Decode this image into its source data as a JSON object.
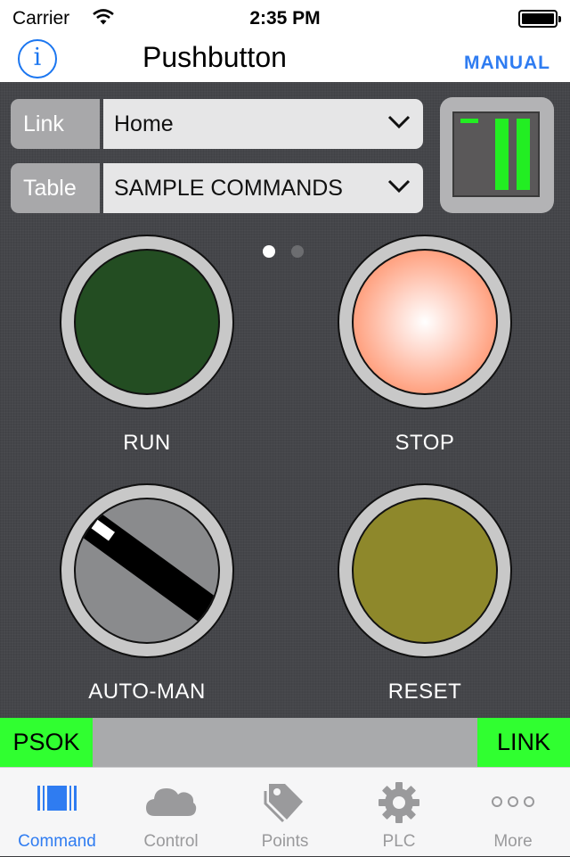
{
  "status_bar": {
    "carrier": "Carrier",
    "time": "2:35 PM"
  },
  "nav": {
    "title": "Pushbutton",
    "info_icon": "info-icon",
    "info_glyph": "i",
    "right_button": "MANUAL"
  },
  "selectors": {
    "link": {
      "label": "Link",
      "value": "Home"
    },
    "table": {
      "label": "Table",
      "value": "SAMPLE COMMANDS"
    }
  },
  "page_dots": {
    "count": 2,
    "active": 0
  },
  "controls": {
    "run": {
      "label": "RUN",
      "color": "#234d22"
    },
    "stop": {
      "label": "STOP",
      "color": "#ff9f7d"
    },
    "auto_man": {
      "label": "AUTO-MAN"
    },
    "reset": {
      "label": "RESET",
      "color": "#8e882b"
    }
  },
  "indicators": {
    "left": "PSOK",
    "right": "LINK",
    "color": "#30ff30"
  },
  "tabs": [
    {
      "label": "Command",
      "icon": "barcode-icon",
      "active": true
    },
    {
      "label": "Control",
      "icon": "cloud-icon",
      "active": false
    },
    {
      "label": "Points",
      "icon": "tag-icon",
      "active": false
    },
    {
      "label": "PLC",
      "icon": "gear-icon",
      "active": false
    },
    {
      "label": "More",
      "icon": "more-icon",
      "active": false
    }
  ],
  "colors": {
    "accent": "#2f7cf1",
    "background": "#45464a",
    "indicator_green": "#30ff30"
  }
}
